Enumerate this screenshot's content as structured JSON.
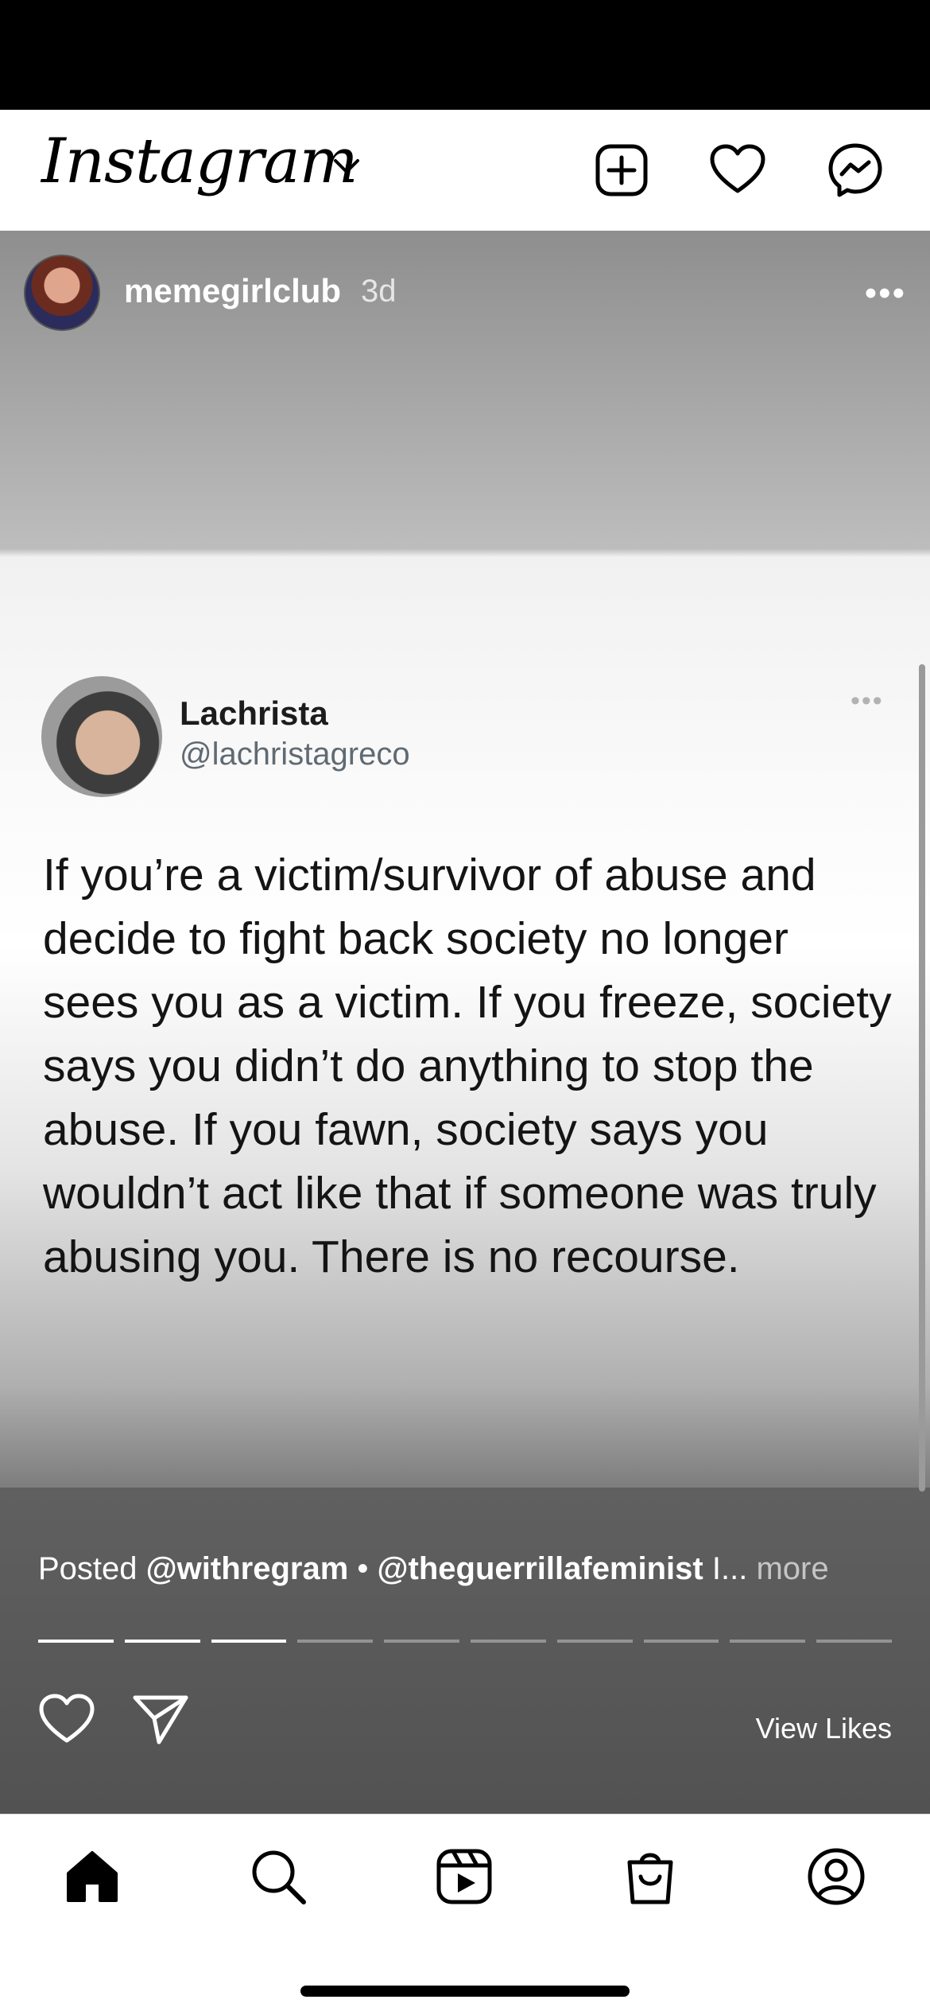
{
  "app": {
    "brand": "Instagram"
  },
  "post": {
    "username": "memegirlclub",
    "time": "3d",
    "more": "•••"
  },
  "tweet": {
    "name": "Lachrista",
    "handle": "@lachristagreco",
    "more": "•••",
    "text": "If you’re a victim/survivor of abuse and decide to fight back society no longer sees you as a victim. If you freeze, society says you didn’t do anything to stop the abuse. If you fawn, society says you wouldn’t act like that if someone was truly abusing you. There is no recourse."
  },
  "caption": {
    "prefix": "Posted",
    "account1": "@withregram",
    "separator": "•",
    "account2": "@theguerrillafeminist",
    "trail": "I...",
    "more": "more"
  },
  "story_progress": {
    "total": 10,
    "completed": 3
  },
  "actions": {
    "view_likes": "View Likes"
  },
  "icons": {
    "top_bar": [
      "chevron-down-icon",
      "new-post-icon",
      "heart-icon",
      "messenger-icon"
    ],
    "bottom_nav": [
      "home-icon",
      "search-icon",
      "reels-icon",
      "shop-icon",
      "profile-icon"
    ]
  }
}
